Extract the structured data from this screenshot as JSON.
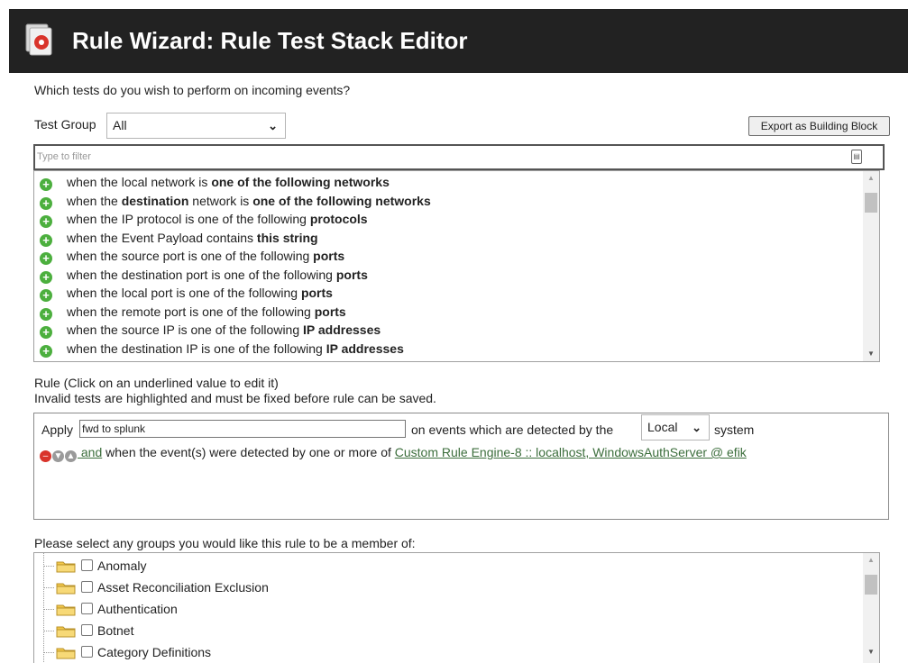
{
  "header": {
    "title": "Rule Wizard: Rule Test Stack Editor",
    "icon": "wizard-icon"
  },
  "prompt": "Which tests do you wish to perform on incoming events?",
  "test_group": {
    "label": "Test Group",
    "selected": "All"
  },
  "export_button": "Export as Building Block",
  "filter": {
    "placeholder": "Type to filter"
  },
  "tests": [
    {
      "parts": [
        {
          "t": "when the local network is ",
          "b": false
        },
        {
          "t": "one of the following networks",
          "b": true
        }
      ]
    },
    {
      "parts": [
        {
          "t": "when the ",
          "b": false
        },
        {
          "t": "destination",
          "b": true
        },
        {
          "t": " network is ",
          "b": false
        },
        {
          "t": "one of the following networks",
          "b": true
        }
      ]
    },
    {
      "parts": [
        {
          "t": "when the IP protocol is one of the following ",
          "b": false
        },
        {
          "t": "protocols",
          "b": true
        }
      ]
    },
    {
      "parts": [
        {
          "t": "when the Event Payload contains ",
          "b": false
        },
        {
          "t": "this string",
          "b": true
        }
      ]
    },
    {
      "parts": [
        {
          "t": "when the source port is one of the following ",
          "b": false
        },
        {
          "t": "ports",
          "b": true
        }
      ]
    },
    {
      "parts": [
        {
          "t": "when the destination port is one of the following ",
          "b": false
        },
        {
          "t": "ports",
          "b": true
        }
      ]
    },
    {
      "parts": [
        {
          "t": "when the local port is one of the following ",
          "b": false
        },
        {
          "t": "ports",
          "b": true
        }
      ]
    },
    {
      "parts": [
        {
          "t": "when the remote port is one of the following ",
          "b": false
        },
        {
          "t": "ports",
          "b": true
        }
      ]
    },
    {
      "parts": [
        {
          "t": "when the source IP is one of the following ",
          "b": false
        },
        {
          "t": "IP addresses",
          "b": true
        }
      ]
    },
    {
      "parts": [
        {
          "t": "when the destination IP is one of the following ",
          "b": false
        },
        {
          "t": "IP addresses",
          "b": true
        }
      ]
    }
  ],
  "rule": {
    "instructions_1": "Rule (Click on an underlined value to edit it)",
    "instructions_2": "Invalid tests are highlighted and must be fixed before rule can be saved.",
    "apply_label": "Apply",
    "rule_name": "fwd to splunk",
    "events_text": "on events which are detected by the",
    "system_select": "Local",
    "system_label": "system",
    "condition_and": " and",
    "condition_text": " when the event(s) were detected by one or more of ",
    "condition_link": "Custom Rule Engine-8 :: localhost, WindowsAuthServer @ efik"
  },
  "groups": {
    "label": "Please select any groups you would like this rule to be a member of:",
    "items": [
      "Anomaly",
      "Asset Reconciliation Exclusion",
      "Authentication",
      "Botnet",
      "Category Definitions"
    ]
  },
  "colors": {
    "header_bg": "#222222",
    "add_icon": "#4caf3e",
    "remove_icon": "#d9342b",
    "link": "#3c6e3c",
    "folder": "#f3c84a"
  }
}
